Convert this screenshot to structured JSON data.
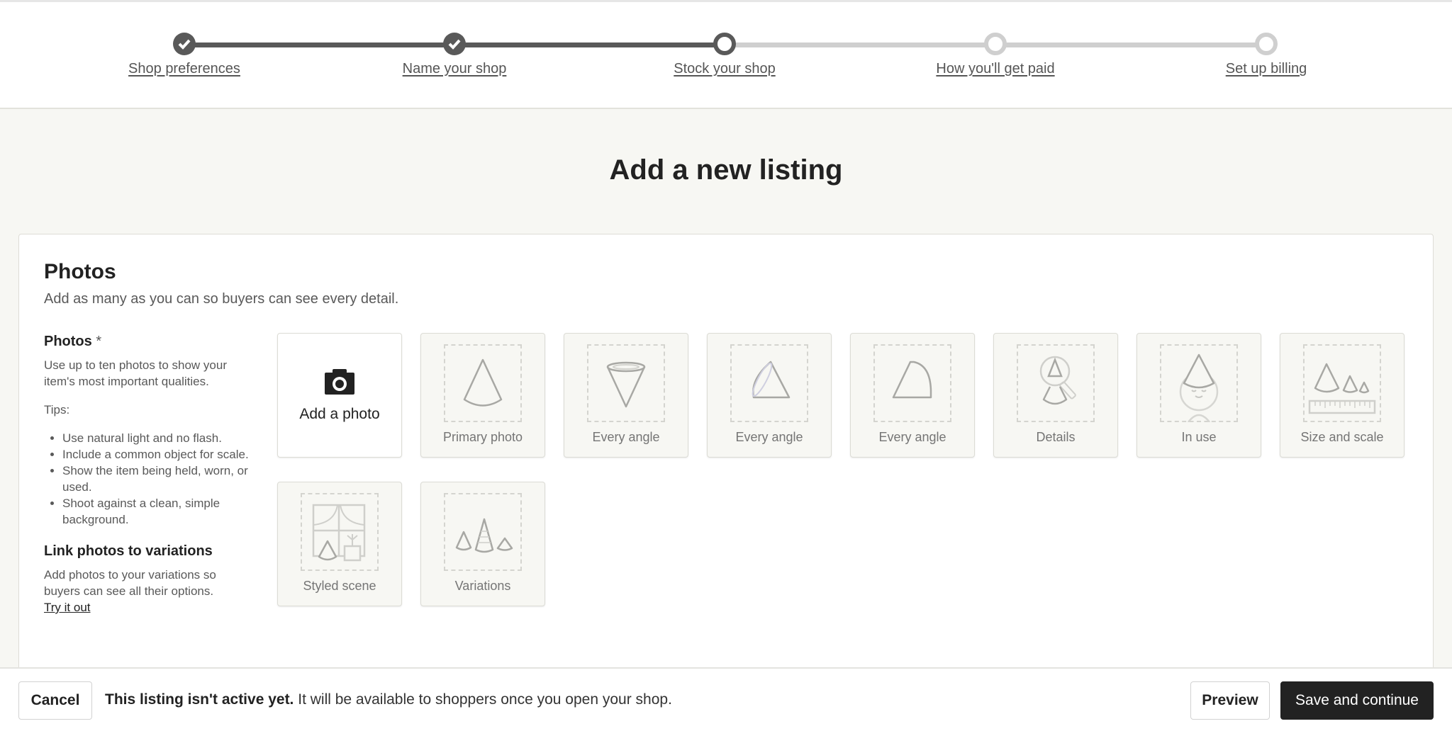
{
  "stepper": {
    "steps": [
      {
        "label": "Shop preferences",
        "state": "complete"
      },
      {
        "label": "Name your shop",
        "state": "complete"
      },
      {
        "label": "Stock your shop",
        "state": "current"
      },
      {
        "label": "How you'll get paid",
        "state": "upcoming"
      },
      {
        "label": "Set up billing",
        "state": "upcoming"
      }
    ]
  },
  "page": {
    "title": "Add a new listing"
  },
  "photos": {
    "heading": "Photos",
    "subtitle": "Add as many as you can so buyers can see every detail.",
    "field_label": "Photos",
    "required_mark": "*",
    "field_help": "Use up to ten photos to show your item's most important qualities.",
    "tips_label": "Tips:",
    "tips": [
      "Use natural light and no flash.",
      "Include a common object for scale.",
      "Show the item being held, worn, or used.",
      "Shoot against a clean, simple background."
    ],
    "link_heading": "Link photos to variations",
    "link_text": "Add photos to your variations so buyers can see all their options.",
    "link_cta": "Try it out",
    "add_photo_label": "Add a photo",
    "slots": [
      {
        "label": "Primary photo",
        "icon": "cone-icon"
      },
      {
        "label": "Every angle",
        "icon": "cone-top-icon"
      },
      {
        "label": "Every angle",
        "icon": "cone-side-icon"
      },
      {
        "label": "Every angle",
        "icon": "cone-back-icon"
      },
      {
        "label": "Details",
        "icon": "magnifier-cone-icon"
      },
      {
        "label": "In use",
        "icon": "person-hat-icon"
      },
      {
        "label": "Size and scale",
        "icon": "cones-ruler-icon"
      },
      {
        "label": "Styled scene",
        "icon": "window-scene-icon"
      },
      {
        "label": "Variations",
        "icon": "three-cones-icon"
      }
    ]
  },
  "footer": {
    "cancel": "Cancel",
    "notice_bold": "This listing isn't active yet.",
    "notice_rest": " It will be available to shoppers once you open your shop.",
    "preview": "Preview",
    "save": "Save and continue"
  },
  "colors": {
    "primary_button": "#222222",
    "step_done": "#595959",
    "step_todo": "#cfcfcf",
    "page_bg": "#f7f7f3"
  }
}
